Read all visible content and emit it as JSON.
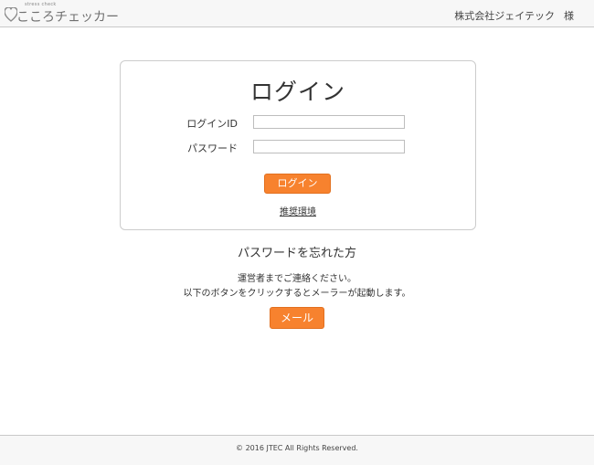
{
  "header": {
    "logo_small": "stress check",
    "logo_text": "こころチェッカー",
    "company": "株式会社ジェイテック",
    "honorific": "様"
  },
  "login": {
    "title": "ログイン",
    "id_label": "ログインID",
    "id_value": "",
    "password_label": "パスワード",
    "password_value": "",
    "login_button": "ログイン",
    "recommended_env_link": "推奨環境"
  },
  "forgot": {
    "title": "パスワードを忘れた方",
    "line1": "運営者までご連絡ください。",
    "line2": "以下のボタンをクリックするとメーラーが起動します。",
    "mail_button": "メール"
  },
  "footer": {
    "copyright": "© 2016 JTEC All Rights Reserved."
  },
  "colors": {
    "accent": "#f7822e",
    "header_bg": "#f7f7f7",
    "border": "#cccccc"
  }
}
